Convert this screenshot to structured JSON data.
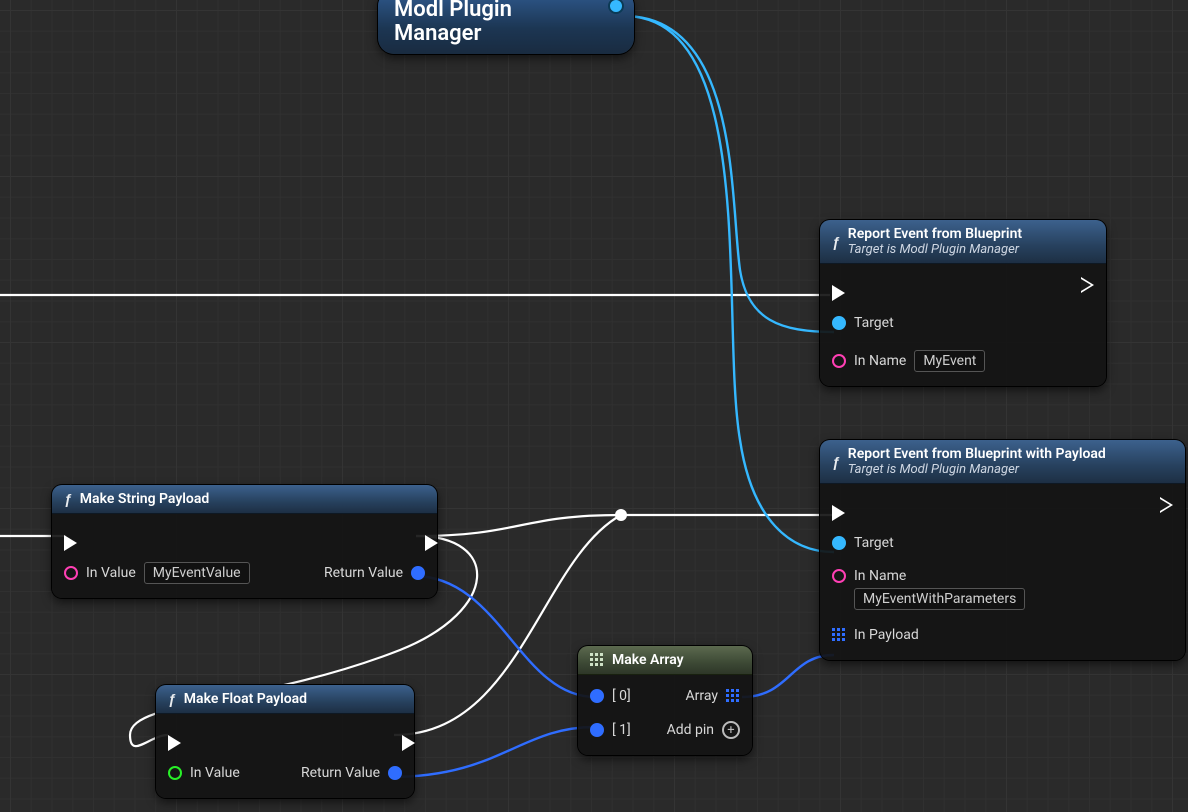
{
  "variable_node": {
    "label": "Modl Plugin\nManager"
  },
  "nodes": {
    "report_event": {
      "title": "Report Event from Blueprint",
      "subtitle": "Target is Modl Plugin Manager",
      "pins": {
        "target": "Target",
        "in_name": "In Name",
        "in_name_value": "MyEvent"
      }
    },
    "report_event_payload": {
      "title": "Report Event from Blueprint with Payload",
      "subtitle": "Target is Modl Plugin Manager",
      "pins": {
        "target": "Target",
        "in_name": "In Name",
        "in_name_value": "MyEventWithParameters",
        "in_payload": "In Payload"
      }
    },
    "make_string": {
      "title": "Make String Payload",
      "pins": {
        "in_value": "In Value",
        "in_value_val": "MyEventValue",
        "return": "Return Value"
      }
    },
    "make_float": {
      "title": "Make Float Payload",
      "pins": {
        "in_value": "In Value",
        "return": "Return Value"
      }
    },
    "make_array": {
      "title": "Make Array",
      "pins": {
        "i0": "[ 0]",
        "i1": "[ 1]",
        "array": "Array",
        "add_pin": "Add pin"
      }
    }
  }
}
